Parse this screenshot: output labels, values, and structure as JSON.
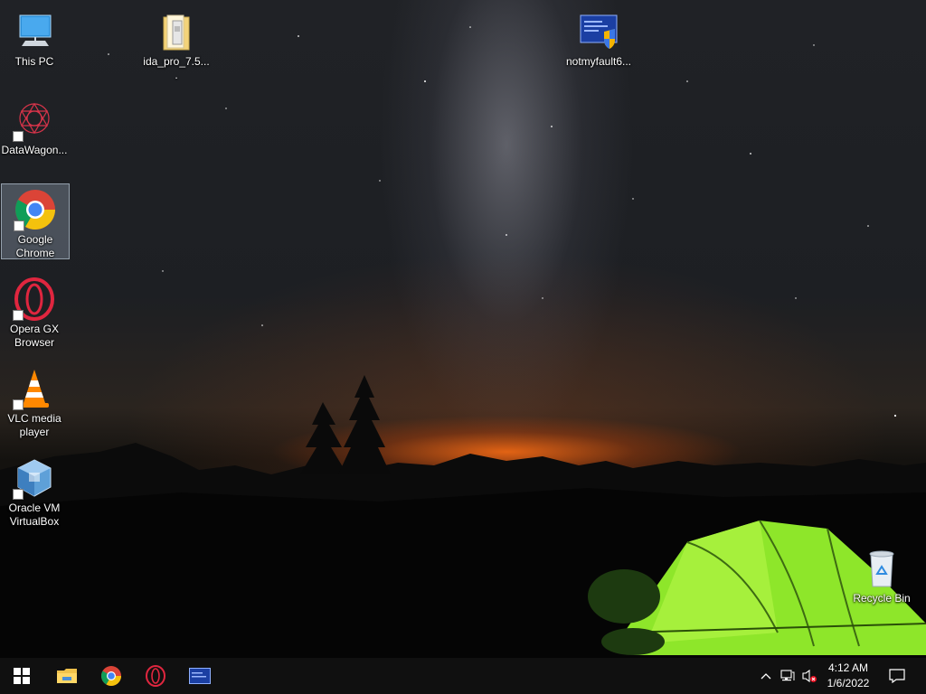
{
  "desktop": {
    "icons": [
      {
        "id": "this-pc",
        "label": "This PC"
      },
      {
        "id": "ida-pro",
        "label": "ida_pro_7.5...."
      },
      {
        "id": "notmyfault",
        "label": "notmyfault6..."
      },
      {
        "id": "datawagon",
        "label": "DataWagon..."
      },
      {
        "id": "google-chrome",
        "label": "Google Chrome"
      },
      {
        "id": "opera-gx",
        "label": "Opera GX Browser"
      },
      {
        "id": "vlc",
        "label": "VLC media player"
      },
      {
        "id": "virtualbox",
        "label": "Oracle VM VirtualBox"
      },
      {
        "id": "recycle-bin",
        "label": "Recycle Bin"
      }
    ],
    "selected_icon": "google-chrome"
  },
  "taskbar": {
    "pinned": [
      {
        "icon": "windows-start-icon"
      },
      {
        "icon": "file-explorer-icon"
      },
      {
        "icon": "chrome-icon"
      },
      {
        "icon": "opera-gx-icon"
      },
      {
        "icon": "application-window-icon"
      }
    ],
    "tray_icons": [
      "chevron-up-icon",
      "network-icon",
      "volume-muted-icon",
      "notification-icon"
    ],
    "clock": {
      "time": "4:12 AM",
      "date": "1/6/2022"
    }
  },
  "colors": {
    "taskbar": "#101010",
    "accent_sky_glow": "#ff6e14",
    "tent_green": "#8ee62a"
  }
}
